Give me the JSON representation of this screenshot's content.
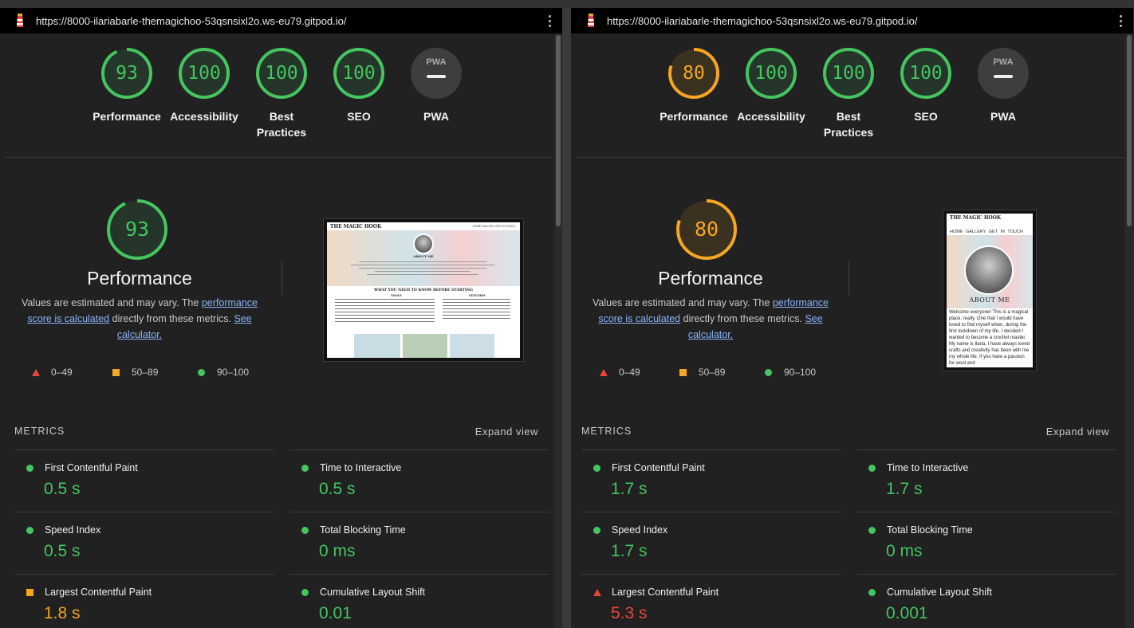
{
  "left": {
    "url": "https://8000-ilariabarle-themagichoo-53qsnsixl2o.ws-eu79.gitpod.io/",
    "scores": [
      {
        "label": "Performance",
        "value": "93",
        "score": 0.93,
        "status": "pass"
      },
      {
        "label": "Accessibility",
        "value": "100",
        "score": 1.0,
        "status": "pass"
      },
      {
        "label": "Best Practices",
        "value": "100",
        "score": 1.0,
        "status": "pass"
      },
      {
        "label": "SEO",
        "value": "100",
        "score": 1.0,
        "status": "pass"
      },
      {
        "label": "PWA",
        "value": "PWA",
        "status": "na"
      }
    ],
    "performance": {
      "score": "93",
      "title": "Performance",
      "desc_prefix": "Values are estimated and may vary. The ",
      "desc_link1": "performance score is calculated",
      "desc_middle": " directly from these metrics. ",
      "desc_link2": "See calculator.",
      "legend": [
        "0–49",
        "50–89",
        "90–100"
      ]
    },
    "preview": {
      "site_title": "THE MAGIC HOOK",
      "nav": "HOME  GALLERY  GET IN TOUCH",
      "heading": "ABOUT ME",
      "section": "WHAT YOU NEED TO KNOW BEFORE STARTING",
      "col1": "TOOLS",
      "col2": "STITCHES"
    },
    "metrics_title": "METRICS",
    "expand_label": "Expand view",
    "metrics": [
      {
        "name": "First Contentful Paint",
        "value": "0.5 s",
        "status": "pass"
      },
      {
        "name": "Time to Interactive",
        "value": "0.5 s",
        "status": "pass"
      },
      {
        "name": "Speed Index",
        "value": "0.5 s",
        "status": "pass"
      },
      {
        "name": "Total Blocking Time",
        "value": "0 ms",
        "status": "pass"
      },
      {
        "name": "Largest Contentful Paint",
        "value": "1.8 s",
        "status": "average"
      },
      {
        "name": "Cumulative Layout Shift",
        "value": "0.01",
        "status": "pass"
      }
    ]
  },
  "right": {
    "url": "https://8000-ilariabarle-themagichoo-53qsnsixl2o.ws-eu79.gitpod.io/",
    "scores": [
      {
        "label": "Performance",
        "value": "80",
        "score": 0.8,
        "status": "average"
      },
      {
        "label": "Accessibility",
        "value": "100",
        "score": 1.0,
        "status": "pass"
      },
      {
        "label": "Best Practices",
        "value": "100",
        "score": 1.0,
        "status": "pass"
      },
      {
        "label": "SEO",
        "value": "100",
        "score": 1.0,
        "status": "pass"
      },
      {
        "label": "PWA",
        "value": "PWA",
        "status": "na"
      }
    ],
    "performance": {
      "score": "80",
      "title": "Performance",
      "desc_prefix": "Values are estimated and may vary. The ",
      "desc_link1": "performance score is calculated",
      "desc_middle": " directly from these metrics. ",
      "desc_link2": "See calculator.",
      "legend": [
        "0–49",
        "50–89",
        "90–100"
      ]
    },
    "preview": {
      "site_title": "THE MAGIC HOOK",
      "nav": "HOME  GALLERY  GET IN TOUCH",
      "heading": "ABOUT ME",
      "body": "Welcome everyone! This is a magical place, really. One that I would have loved to find myself when, during the first lockdown of my life, I decided I wanted to become a crochet master. My name is Ilaria, I have always loved crafts and creativity has been with me my whole life. If you have a passion for wool and"
    },
    "metrics_title": "METRICS",
    "expand_label": "Expand view",
    "metrics": [
      {
        "name": "First Contentful Paint",
        "value": "1.7 s",
        "status": "pass"
      },
      {
        "name": "Time to Interactive",
        "value": "1.7 s",
        "status": "pass"
      },
      {
        "name": "Speed Index",
        "value": "1.7 s",
        "status": "pass"
      },
      {
        "name": "Total Blocking Time",
        "value": "0 ms",
        "status": "pass"
      },
      {
        "name": "Largest Contentful Paint",
        "value": "5.3 s",
        "status": "fail"
      },
      {
        "name": "Cumulative Layout Shift",
        "value": "0.001",
        "status": "pass"
      }
    ]
  },
  "colors": {
    "pass": "#44c560",
    "average": "#f5a623",
    "fail": "#e8453c"
  }
}
